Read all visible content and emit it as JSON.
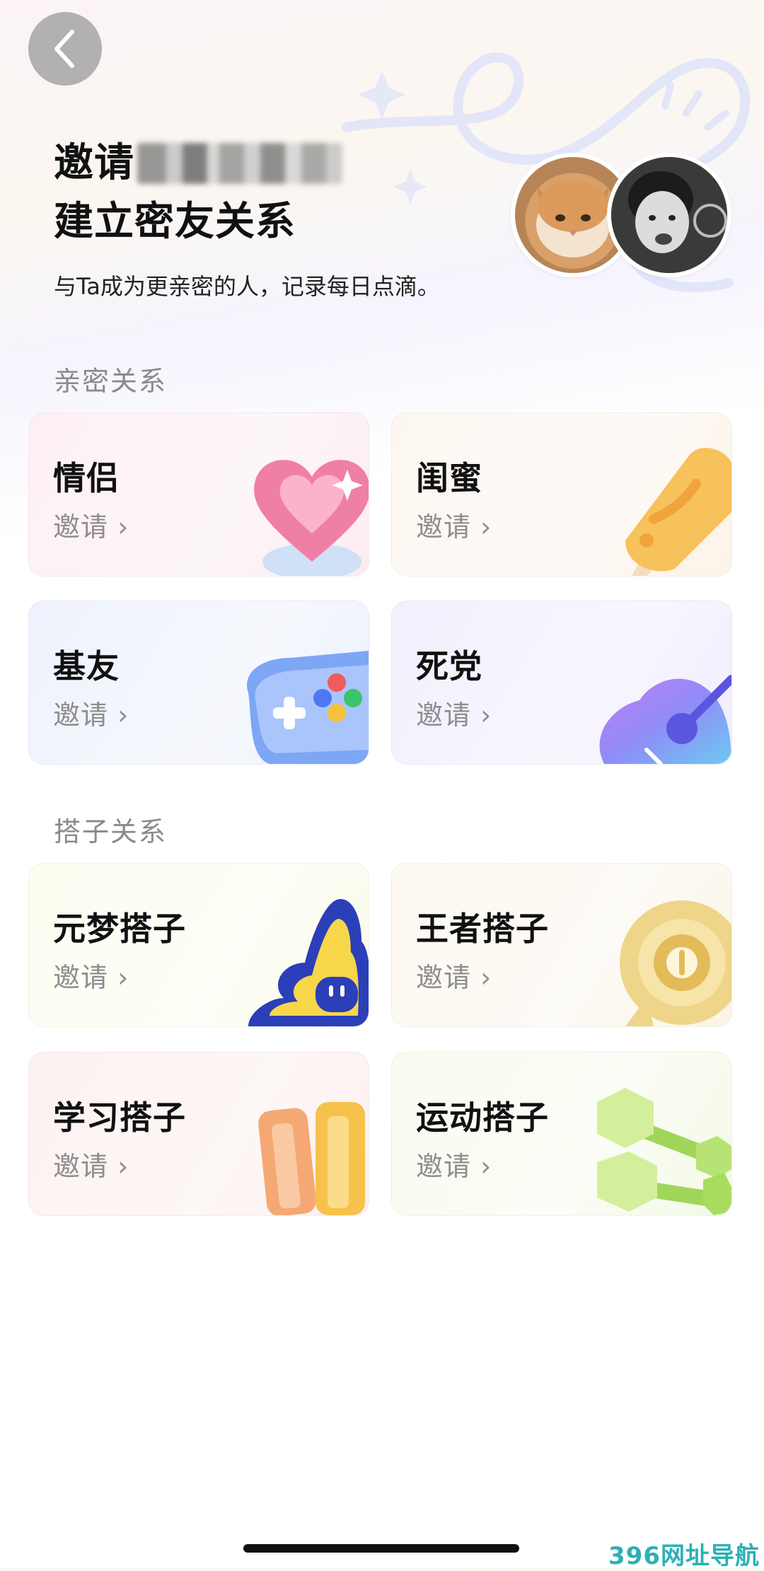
{
  "header": {
    "title_prefix": "邀请",
    "title_line2": "建立密友关系",
    "subtitle": "与Ta成为更亲密的人，记录每日点滴。"
  },
  "sections": [
    {
      "title": "亲密关系",
      "cards": [
        {
          "name": "情侣",
          "invite": "邀请",
          "icon": "heart-icon"
        },
        {
          "name": "闺蜜",
          "invite": "邀请",
          "icon": "popsicle-icon"
        },
        {
          "name": "基友",
          "invite": "邀请",
          "icon": "gamepad-icon"
        },
        {
          "name": "死党",
          "invite": "邀请",
          "icon": "guitar-icon"
        }
      ]
    },
    {
      "title": "搭子关系",
      "cards": [
        {
          "name": "元梦搭子",
          "invite": "邀请",
          "icon": "star-mascot-icon"
        },
        {
          "name": "王者搭子",
          "invite": "邀请",
          "icon": "gold-medal-icon"
        },
        {
          "name": "学习搭子",
          "invite": "邀请",
          "icon": "pencil-icon"
        },
        {
          "name": "运动搭子",
          "invite": "邀请",
          "icon": "dumbbell-icon"
        }
      ]
    }
  ],
  "watermark": "396网址导航",
  "colors": {
    "accent_teal": "#2bb0b5",
    "section_gray": "#8a8a8a"
  }
}
